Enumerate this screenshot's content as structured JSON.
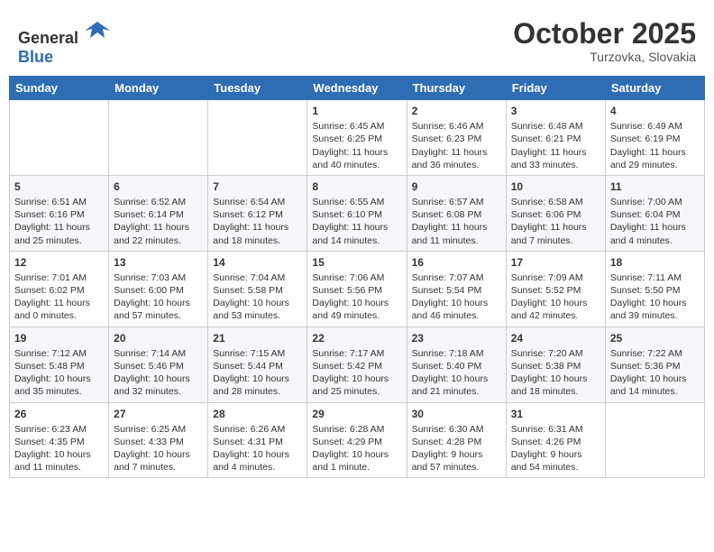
{
  "header": {
    "logo_general": "General",
    "logo_blue": "Blue",
    "month_title": "October 2025",
    "location": "Turzovka, Slovakia"
  },
  "weekdays": [
    "Sunday",
    "Monday",
    "Tuesday",
    "Wednesday",
    "Thursday",
    "Friday",
    "Saturday"
  ],
  "weeks": [
    [
      {
        "day": "",
        "info": ""
      },
      {
        "day": "",
        "info": ""
      },
      {
        "day": "",
        "info": ""
      },
      {
        "day": "1",
        "info": "Sunrise: 6:45 AM\nSunset: 6:25 PM\nDaylight: 11 hours\nand 40 minutes."
      },
      {
        "day": "2",
        "info": "Sunrise: 6:46 AM\nSunset: 6:23 PM\nDaylight: 11 hours\nand 36 minutes."
      },
      {
        "day": "3",
        "info": "Sunrise: 6:48 AM\nSunset: 6:21 PM\nDaylight: 11 hours\nand 33 minutes."
      },
      {
        "day": "4",
        "info": "Sunrise: 6:49 AM\nSunset: 6:19 PM\nDaylight: 11 hours\nand 29 minutes."
      }
    ],
    [
      {
        "day": "5",
        "info": "Sunrise: 6:51 AM\nSunset: 6:16 PM\nDaylight: 11 hours\nand 25 minutes."
      },
      {
        "day": "6",
        "info": "Sunrise: 6:52 AM\nSunset: 6:14 PM\nDaylight: 11 hours\nand 22 minutes."
      },
      {
        "day": "7",
        "info": "Sunrise: 6:54 AM\nSunset: 6:12 PM\nDaylight: 11 hours\nand 18 minutes."
      },
      {
        "day": "8",
        "info": "Sunrise: 6:55 AM\nSunset: 6:10 PM\nDaylight: 11 hours\nand 14 minutes."
      },
      {
        "day": "9",
        "info": "Sunrise: 6:57 AM\nSunset: 6:08 PM\nDaylight: 11 hours\nand 11 minutes."
      },
      {
        "day": "10",
        "info": "Sunrise: 6:58 AM\nSunset: 6:06 PM\nDaylight: 11 hours\nand 7 minutes."
      },
      {
        "day": "11",
        "info": "Sunrise: 7:00 AM\nSunset: 6:04 PM\nDaylight: 11 hours\nand 4 minutes."
      }
    ],
    [
      {
        "day": "12",
        "info": "Sunrise: 7:01 AM\nSunset: 6:02 PM\nDaylight: 11 hours\nand 0 minutes."
      },
      {
        "day": "13",
        "info": "Sunrise: 7:03 AM\nSunset: 6:00 PM\nDaylight: 10 hours\nand 57 minutes."
      },
      {
        "day": "14",
        "info": "Sunrise: 7:04 AM\nSunset: 5:58 PM\nDaylight: 10 hours\nand 53 minutes."
      },
      {
        "day": "15",
        "info": "Sunrise: 7:06 AM\nSunset: 5:56 PM\nDaylight: 10 hours\nand 49 minutes."
      },
      {
        "day": "16",
        "info": "Sunrise: 7:07 AM\nSunset: 5:54 PM\nDaylight: 10 hours\nand 46 minutes."
      },
      {
        "day": "17",
        "info": "Sunrise: 7:09 AM\nSunset: 5:52 PM\nDaylight: 10 hours\nand 42 minutes."
      },
      {
        "day": "18",
        "info": "Sunrise: 7:11 AM\nSunset: 5:50 PM\nDaylight: 10 hours\nand 39 minutes."
      }
    ],
    [
      {
        "day": "19",
        "info": "Sunrise: 7:12 AM\nSunset: 5:48 PM\nDaylight: 10 hours\nand 35 minutes."
      },
      {
        "day": "20",
        "info": "Sunrise: 7:14 AM\nSunset: 5:46 PM\nDaylight: 10 hours\nand 32 minutes."
      },
      {
        "day": "21",
        "info": "Sunrise: 7:15 AM\nSunset: 5:44 PM\nDaylight: 10 hours\nand 28 minutes."
      },
      {
        "day": "22",
        "info": "Sunrise: 7:17 AM\nSunset: 5:42 PM\nDaylight: 10 hours\nand 25 minutes."
      },
      {
        "day": "23",
        "info": "Sunrise: 7:18 AM\nSunset: 5:40 PM\nDaylight: 10 hours\nand 21 minutes."
      },
      {
        "day": "24",
        "info": "Sunrise: 7:20 AM\nSunset: 5:38 PM\nDaylight: 10 hours\nand 18 minutes."
      },
      {
        "day": "25",
        "info": "Sunrise: 7:22 AM\nSunset: 5:36 PM\nDaylight: 10 hours\nand 14 minutes."
      }
    ],
    [
      {
        "day": "26",
        "info": "Sunrise: 6:23 AM\nSunset: 4:35 PM\nDaylight: 10 hours\nand 11 minutes."
      },
      {
        "day": "27",
        "info": "Sunrise: 6:25 AM\nSunset: 4:33 PM\nDaylight: 10 hours\nand 7 minutes."
      },
      {
        "day": "28",
        "info": "Sunrise: 6:26 AM\nSunset: 4:31 PM\nDaylight: 10 hours\nand 4 minutes."
      },
      {
        "day": "29",
        "info": "Sunrise: 6:28 AM\nSunset: 4:29 PM\nDaylight: 10 hours\nand 1 minute."
      },
      {
        "day": "30",
        "info": "Sunrise: 6:30 AM\nSunset: 4:28 PM\nDaylight: 9 hours\nand 57 minutes."
      },
      {
        "day": "31",
        "info": "Sunrise: 6:31 AM\nSunset: 4:26 PM\nDaylight: 9 hours\nand 54 minutes."
      },
      {
        "day": "",
        "info": ""
      }
    ]
  ]
}
